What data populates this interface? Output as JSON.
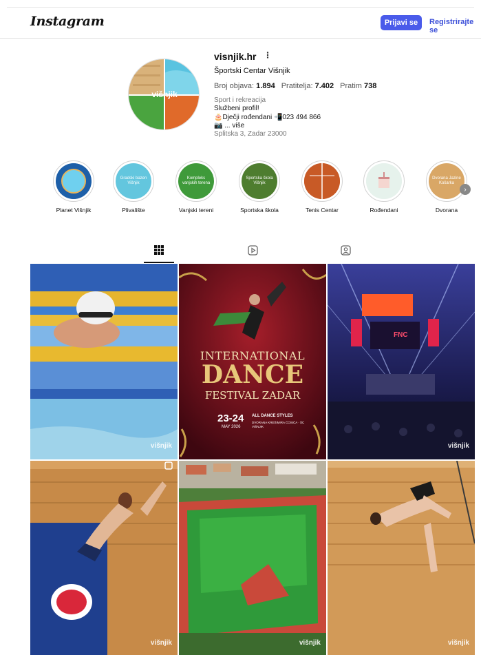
{
  "header": {
    "logo_text": "Instagram",
    "login_label": "Prijavi se",
    "register_label": "Registrirajte se"
  },
  "profile": {
    "username": "visnjik.hr",
    "more_icon": "more-dots-icon",
    "full_name": "Športski Centar Višnjik",
    "avatar_text": "višnjik",
    "stats": {
      "posts_label": "Broj objava:",
      "posts_value": "1.894",
      "followers_label": "Pratitelja:",
      "followers_value": "7.402",
      "following_label": "Pratim",
      "following_value": "738"
    },
    "bio": {
      "category": "Sport i rekreacija",
      "line1": "Službeni profil!",
      "line2": "🎂Dječji rođendani 📲023 494 866",
      "line3": "📷 ... više",
      "address": "Splitska 3, Zadar 23000"
    }
  },
  "highlights": [
    {
      "label": "Planet Višnjik",
      "cover_text": ""
    },
    {
      "label": "Plivalište",
      "cover_text": "Gradski bazen Višnjik"
    },
    {
      "label": "Vanjski tereni",
      "cover_text": "Kompleks vanjskih terena"
    },
    {
      "label": "Sportska škola",
      "cover_text": "Sportska škola Višnjik"
    },
    {
      "label": "Tenis Centar",
      "cover_text": ""
    },
    {
      "label": "Rođendani",
      "cover_text": ""
    },
    {
      "label": "Dvorana",
      "cover_text": "Dvorana Jazine Košarka"
    }
  ],
  "tabs": [
    {
      "name": "posts",
      "icon": "grid-icon"
    },
    {
      "name": "reels",
      "icon": "reels-icon"
    },
    {
      "name": "tagged",
      "icon": "tagged-icon"
    }
  ],
  "posts": [
    {
      "subject": "swimmer",
      "watermark": "višnjik"
    },
    {
      "subject": "dance-festival",
      "line1": "INTERNATIONAL",
      "line2": "DANCE",
      "line3": "FESTIVAL ZADAR",
      "dates": "23-24",
      "month": "MAY 2026",
      "styles": "ALL DANCE STYLES",
      "venue": "DVORANA KREŠIMIRA ĆOSIĆA · ŠC VIŠNJIK"
    },
    {
      "subject": "fnc-arena",
      "screen_text": "FNC",
      "watermark": "višnjik"
    },
    {
      "subject": "diver-1",
      "watermark": "višnjik"
    },
    {
      "subject": "aerial-stadium",
      "watermark": "višnjik"
    },
    {
      "subject": "diver-2",
      "watermark": "višnjik"
    }
  ],
  "colors": {
    "accent": "#4a5bea",
    "link": "#3c4fd8"
  }
}
